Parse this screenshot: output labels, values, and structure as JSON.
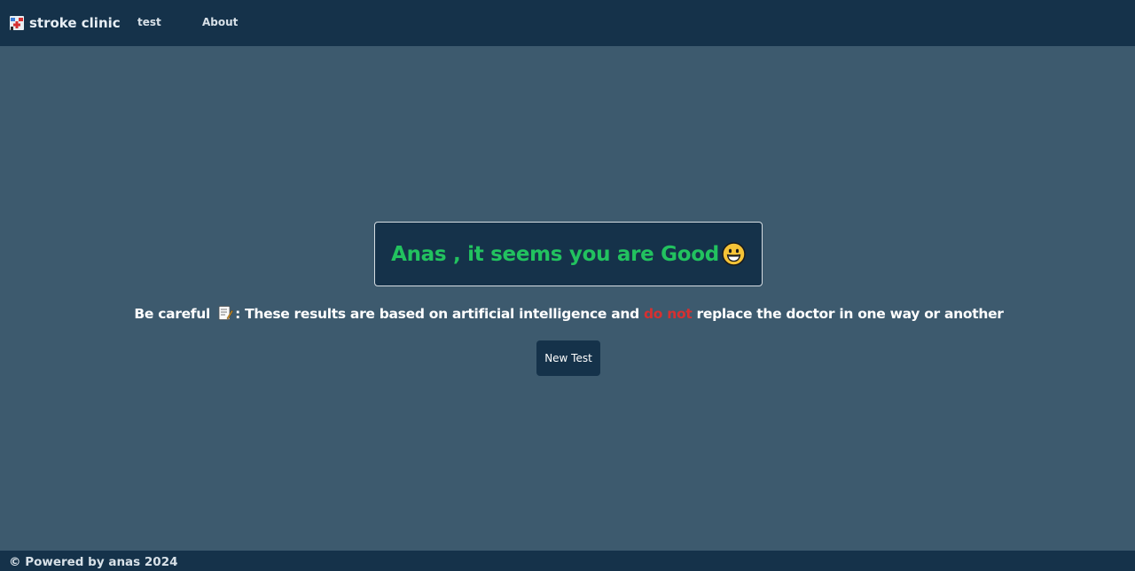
{
  "navbar": {
    "brand": "stroke clinic",
    "brand_icon": "clinic-icon",
    "links": [
      "test",
      "About"
    ]
  },
  "result": {
    "message": "Anas , it seems you are Good",
    "icon": "grinning-face-icon",
    "color": "#22c25f"
  },
  "warning": {
    "prefix": "Be careful",
    "icon": "memo-icon",
    "text_before": ": These results are based on artificial intelligence and",
    "highlight": "do not",
    "text_after": "replace the doctor in one way or another",
    "highlight_color": "#d63031"
  },
  "actions": {
    "new_test_label": "New Test"
  },
  "footer": {
    "text": "© Powered by anas 2024"
  },
  "colors": {
    "navbar_bg": "#15324a",
    "page_bg": "#3d5a6e"
  }
}
